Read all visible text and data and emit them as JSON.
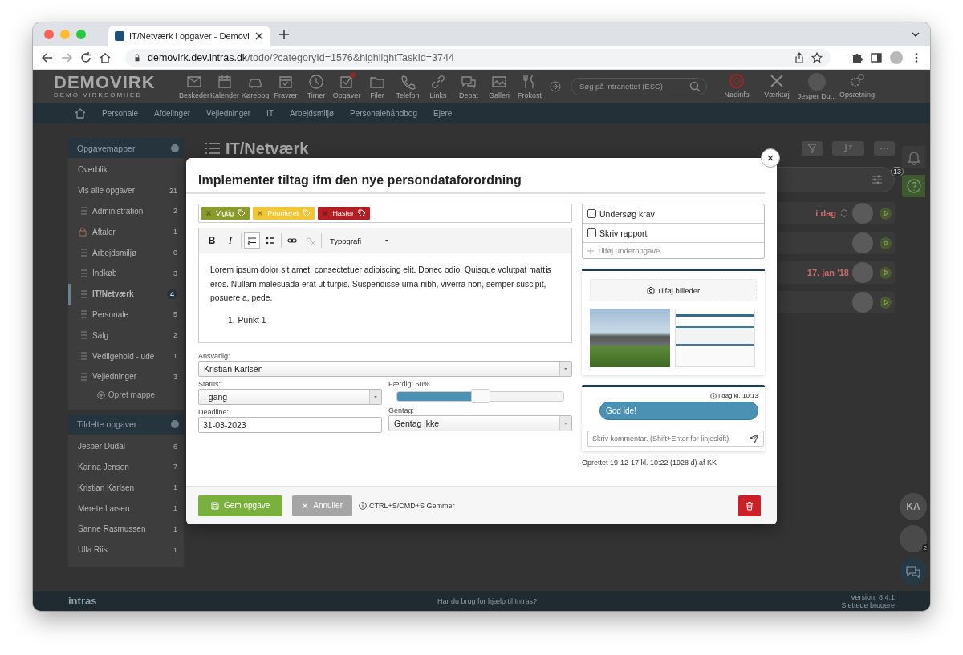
{
  "browser": {
    "tab_title": "IT/Netværk i opgaver - Demovi",
    "url_host": "demovirk.dev.intras.dk",
    "url_path": "/todo/?categoryId=1576&highlightTaskId=3744"
  },
  "header": {
    "logo": "DEMOVIRK",
    "logo_subtitle": "DEMO VIRKSOMHED",
    "nav": [
      {
        "label": "Beskeder",
        "alert": false
      },
      {
        "label": "Kalender",
        "alert": false
      },
      {
        "label": "Kørebog",
        "alert": false
      },
      {
        "label": "Fravær",
        "alert": false
      },
      {
        "label": "Timer",
        "alert": false
      },
      {
        "label": "Opgaver",
        "alert": true
      },
      {
        "label": "Filer",
        "alert": false
      },
      {
        "label": "Telefon",
        "alert": false
      },
      {
        "label": "Links",
        "alert": false
      },
      {
        "label": "Debat",
        "alert": false
      },
      {
        "label": "Galleri",
        "alert": false
      },
      {
        "label": "Frokost",
        "alert": false
      }
    ],
    "search": {
      "placeholder": "Søg på intranettet (ESC)"
    },
    "tools": [
      {
        "label": "Nødinfo",
        "kind": "lifebuoy"
      },
      {
        "label": "Værktøj",
        "kind": "tools"
      },
      {
        "label": "Jesper Du...",
        "kind": "avatar"
      },
      {
        "label": "Opsætning",
        "kind": "gears"
      }
    ]
  },
  "menu": [
    "Personale",
    "Afdelinger",
    "Vejledninger",
    "IT",
    "Arbejdsmiljø",
    "Personalehåndbog",
    "Ejere"
  ],
  "sidebar": {
    "folders_title": "Opgavemapper",
    "links": [
      {
        "label": "Overblik"
      },
      {
        "label": "Vis alle opgaver",
        "count": "21"
      }
    ],
    "folders": [
      {
        "label": "Administration",
        "count": "2",
        "locked": false,
        "selected": false
      },
      {
        "label": "Aftaler",
        "count": "1",
        "locked": true,
        "selected": false
      },
      {
        "label": "Arbejdsmiljø",
        "count": "0",
        "locked": false,
        "selected": false
      },
      {
        "label": "Indkøb",
        "count": "3",
        "locked": false,
        "selected": false
      },
      {
        "label": "IT/Netværk",
        "count": "4",
        "locked": false,
        "selected": true
      },
      {
        "label": "Personale",
        "count": "5",
        "locked": false,
        "selected": false
      },
      {
        "label": "Salg",
        "count": "2",
        "locked": false,
        "selected": false
      },
      {
        "label": "Vedligehold - ude",
        "count": "1",
        "locked": false,
        "selected": false
      },
      {
        "label": "Vejledninger",
        "count": "3",
        "locked": false,
        "selected": false
      }
    ],
    "new_folder": "Opret mappe",
    "assigned_title": "Tildelte opgaver",
    "assigned": [
      {
        "label": "Jesper Dudal",
        "count": "6"
      },
      {
        "label": "Karina Jensen",
        "count": "7"
      },
      {
        "label": "Kristian Karlsen",
        "count": "1"
      },
      {
        "label": "Merete Larsen",
        "count": "1"
      },
      {
        "label": "Sanne Rasmussen",
        "count": "1"
      },
      {
        "label": "Ulla Riis",
        "count": "1"
      }
    ]
  },
  "content": {
    "title": "IT/Netværk",
    "tasks": [
      {
        "due": "i dag",
        "recurring": true
      },
      {
        "recurring": false
      },
      {
        "due": "17. jan '18",
        "recurring": false
      },
      {
        "recurring": false
      }
    ]
  },
  "rail": {
    "help_badge": "13",
    "chat_avatar": "KA",
    "group_badge": "2"
  },
  "footer": {
    "brand": "intras",
    "help": "Har du brug for hjælp til Intras?",
    "version": "Version: 8.4.1",
    "deleted_users": "Slettede brugere"
  },
  "task": {
    "title": "Implementer tiltag ifm den nye persondataforordning",
    "tags": [
      {
        "label": "Vigtig",
        "color": "#8a9b2c"
      },
      {
        "label": "Prioriteret",
        "color": "#f0c536"
      },
      {
        "label": "Haster",
        "color": "#b31f25"
      }
    ],
    "toolbar": [
      {
        "kind": "bold",
        "label": "B",
        "active": false,
        "disabled": false
      },
      {
        "kind": "italic",
        "label": "I",
        "active": false,
        "disabled": false
      },
      {
        "kind": "ordered-list",
        "active": true,
        "disabled": false
      },
      {
        "kind": "bullet-list",
        "active": false,
        "disabled": false
      },
      {
        "kind": "link",
        "active": false,
        "disabled": false
      },
      {
        "kind": "unlink",
        "active": false,
        "disabled": true
      }
    ],
    "style_menu": "Typografi",
    "paragraph": "Lorem ipsum dolor sit amet, consectetuer adipiscing elit. Donec odio. Quisque volutpat mattis eros. Nullam malesuada erat ut turpis. Suspendisse urna nibh, viverra non, semper suscipit, posuere a, pede.",
    "list_items": [
      {
        "marker": "1.",
        "text": "Punkt 1"
      }
    ],
    "responsible": {
      "label": "Ansvarlig:",
      "value": "Kristian Karlsen"
    },
    "status": {
      "label": "Status:",
      "value": "I gang"
    },
    "progress": {
      "label": "Færdig: 50%",
      "level": 0.5
    },
    "deadline": {
      "label": "Deadline:",
      "value": "31-03-2023"
    },
    "repeat": {
      "label": "Gentag:",
      "value": "Gentag ikke"
    },
    "subtasks": [
      {
        "label": "Undersøg krav",
        "checked": false
      },
      {
        "label": "Skriv rapport",
        "checked": false
      }
    ],
    "add_subtask": "Tilføj underopgave",
    "add_images": "Tilføj billeder",
    "thumbnails": [
      {
        "kind": "photo"
      },
      {
        "kind": "screenshot"
      }
    ],
    "comments": [
      {
        "time": "i dag kl. 10:13",
        "text": "God ide!"
      }
    ],
    "comment_field": {
      "placeholder": "Skriv kommentar. (Shift+Enter for linjeskift)"
    },
    "created": "Oprettet 19-12-17 kl. 10:22 (1928 d) af KK",
    "save": "Gem opgave",
    "cancel": "Annuller",
    "hint": "CTRL+S/CMD+S Gemmer"
  }
}
